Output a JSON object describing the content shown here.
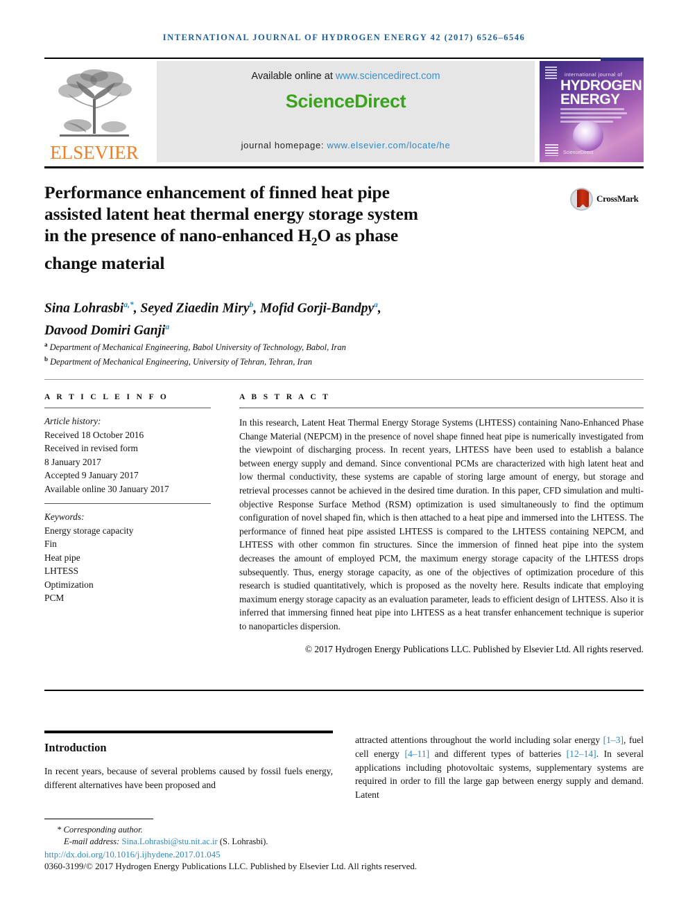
{
  "running_head": "INTERNATIONAL JOURNAL OF HYDROGEN ENERGY 42 (2017) 6526–6546",
  "masthead": {
    "publisher_name": "ELSEVIER",
    "available_prefix": "Available online at ",
    "available_url": "www.sciencedirect.com",
    "sciencedirect_wordmark": "ScienceDirect",
    "homepage_prefix": "journal homepage: ",
    "homepage_url": "www.elsevier.com/locate/he",
    "cover": {
      "line_small": "international journal of",
      "line1": "HYDROGEN",
      "line2": "ENERGY",
      "sciencedirect_mark": "ScienceDirect"
    },
    "accent_blue": "#2b88c4",
    "accent_green": "#3aa21d",
    "accent_orange": "#f57c20"
  },
  "crossmark": {
    "label": "CrossMark"
  },
  "title": {
    "line1": "Performance enhancement of finned heat pipe",
    "line2": "assisted latent heat thermal energy storage system",
    "line3_a": "in the presence of nano-enhanced H",
    "line3_sub": "2",
    "line3_b": "O as phase",
    "line4": "change material"
  },
  "authors": {
    "line1": "Sina Lohrasbi",
    "a1": "a,*",
    "name2": "Seyed Ziaedin Miry",
    "a2": "b",
    "name3": "Mofid Gorji-Bandpy",
    "a3": "a",
    "name4": "Davood Domiri Ganji",
    "a4": "a",
    "affiliation_a_marker": "a",
    "affiliation_a": "Department of Mechanical Engineering, Babol University of Technology, Babol, Iran",
    "affiliation_b_marker": "b",
    "affiliation_b": "Department of Mechanical Engineering, University of Tehran, Tehran, Iran"
  },
  "article_info": {
    "heading": "A R T I C L E   I N F O",
    "history_label": "Article history:",
    "history": [
      "Received 18 October 2016",
      "Received in revised form",
      "8 January 2017",
      "Accepted 9 January 2017",
      "Available online 30 January 2017"
    ],
    "keywords_label": "Keywords:",
    "keywords": [
      "Energy storage capacity",
      "Fin",
      "Heat pipe",
      "LHTESS",
      "Optimization",
      "PCM"
    ]
  },
  "abstract": {
    "heading": "A B S T R A C T",
    "text": "In this research, Latent Heat Thermal Energy Storage Systems (LHTESS) containing Nano-Enhanced Phase Change Material (NEPCM) in the presence of novel shape finned heat pipe is numerically investigated from the viewpoint of discharging process. In recent years, LHTESS have been used to establish a balance between energy supply and demand. Since conventional PCMs are characterized with high latent heat and low thermal conductivity, these systems are capable of storing large amount of energy, but storage and retrieval processes cannot be achieved in the desired time duration. In this paper, CFD simulation and multi-objective Response Surface Method (RSM) optimization is used simultaneously to find the optimum configuration of novel shaped fin, which is then attached to a heat pipe and immersed into the LHTESS. The performance of finned heat pipe assisted LHTESS is compared to the LHTESS containing NEPCM, and LHTESS with other common fin structures. Since the immersion of finned heat pipe into the system decreases the amount of employed PCM, the maximum energy storage capacity of the LHTESS drops subsequently. Thus, energy storage capacity, as one of the objectives of optimization procedure of this research is studied quantitatively, which is proposed as the novelty here. Results indicate that employing maximum energy storage capacity as an evaluation parameter, leads to efficient design of LHTESS. Also it is inferred that immersing finned heat pipe into LHTESS as a heat transfer enhancement technique is superior to nanoparticles dispersion.",
    "copyright": "© 2017 Hydrogen Energy Publications LLC. Published by Elsevier Ltd. All rights reserved."
  },
  "introduction": {
    "heading": "Introduction",
    "left_text": "In recent years, because of several problems caused by fossil fuels energy, different alternatives have been proposed and",
    "right_a": "attracted attentions throughout the world including solar energy ",
    "right_ref1": "[1–3]",
    "right_b": ", fuel cell energy ",
    "right_ref2": "[4–11]",
    "right_c": " and different types of batteries ",
    "right_ref3": "[12–14]",
    "right_d": ". In several applications including photovoltaic systems, supplementary systems are required in order to fill the large gap between energy supply and demand. Latent"
  },
  "footer": {
    "corresponding": "* Corresponding author.",
    "email_label": "E-mail address: ",
    "email": "Sina.Lohrasbi@stu.nit.ac.ir",
    "email_suffix": " (S. Lohrasbi).",
    "doi": "http://dx.doi.org/10.1016/j.ijhydene.2017.01.045",
    "issn_line": "0360-3199/© 2017 Hydrogen Energy Publications LLC. Published by Elsevier Ltd. All rights reserved."
  }
}
